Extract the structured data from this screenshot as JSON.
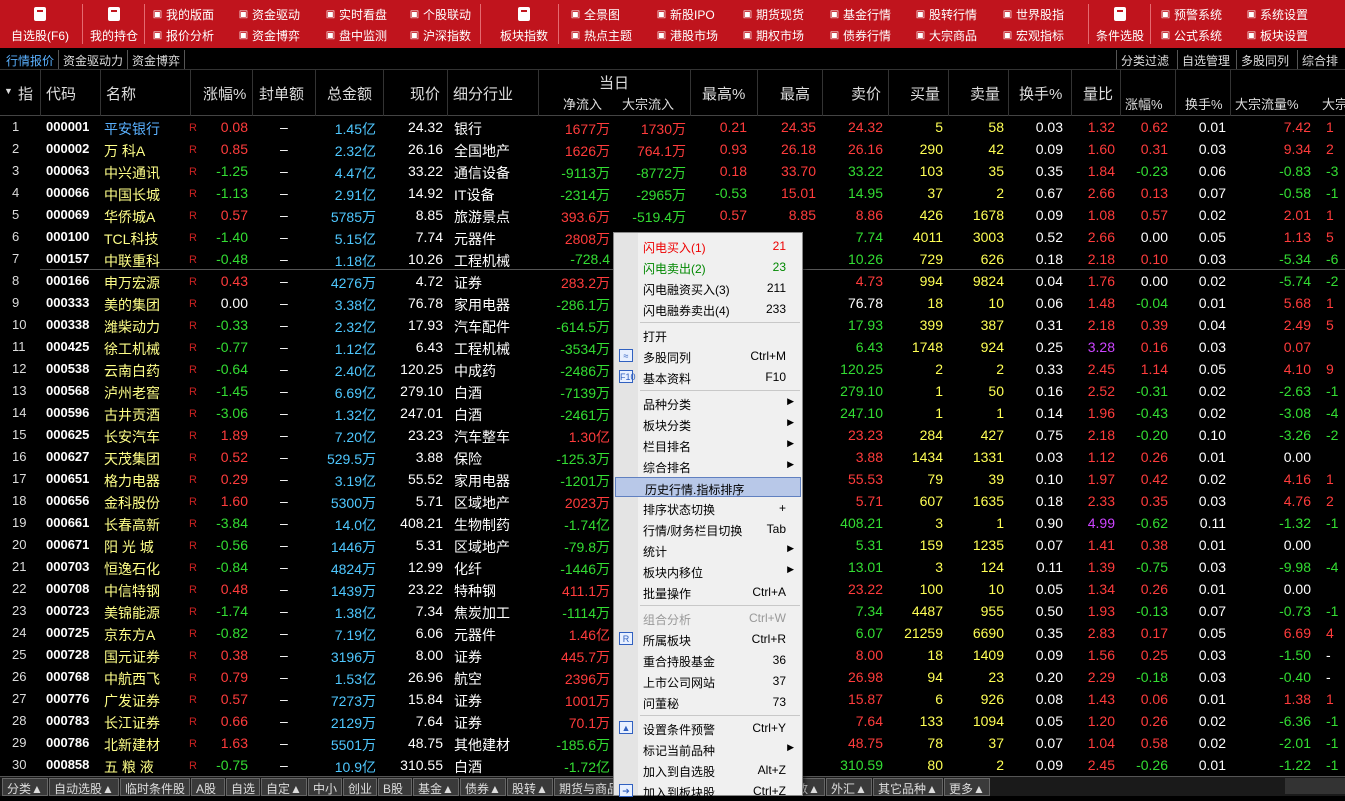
{
  "toolbar": {
    "big": [
      {
        "label": "自选股(F6)",
        "icon": "bookmark-icon"
      },
      {
        "label": "我的持仓",
        "icon": "phone-icon"
      },
      {
        "label": "板块指数",
        "icon": "globe-icon"
      },
      {
        "label": "条件选股",
        "icon": "filter-doc-icon"
      }
    ],
    "small_rows": [
      [
        "我的版面",
        "资金驱动",
        "实时看盘",
        "个股联动"
      ],
      [
        "报价分析",
        "资金博弈",
        "盘中监测",
        "沪深指数"
      ],
      [
        "全景图",
        "新股IPO",
        "期货现货",
        "基金行情",
        "股转行情",
        "世界股指"
      ],
      [
        "热点主题",
        "港股市场",
        "期权市场",
        "债券行情",
        "大宗商品",
        "宏观指标"
      ],
      [
        "预警系统",
        "系统设置"
      ],
      [
        "公式系统",
        "板块设置"
      ]
    ]
  },
  "tabs": [
    "行情报价",
    "资金驱动力",
    "资金博弈"
  ],
  "right_tabs": [
    "分类过滤",
    "自选管理",
    "多股同列",
    "综合排名"
  ],
  "headers": {
    "idx": "指",
    "code": "代码",
    "name": "名称",
    "chg": "涨幅%",
    "seal": "封单额",
    "amt": "总金额",
    "price": "现价",
    "ind": "细分行业",
    "today": "当日",
    "net": "净流入",
    "block": "大宗流入",
    "highp": "最高%",
    "high": "最高",
    "ask": "卖价",
    "bvol": "买量",
    "svol": "卖量",
    "turn": "换手%",
    "vr": "量比",
    "chg2": "涨幅%",
    "turn2": "换手%",
    "bflow": "大宗流量%",
    "bflow2": "大宗"
  },
  "rows": [
    [
      "1",
      "000001",
      "平安银行",
      "0.08",
      "–",
      "1.45亿",
      "24.32",
      "银行",
      "1677万",
      "1730万",
      "0.21",
      "24.35",
      "24.32",
      "5",
      "58",
      "0.03",
      "1.32",
      "0.62",
      "0.01",
      "7.42",
      "1"
    ],
    [
      "2",
      "000002",
      "万 科A",
      "0.85",
      "–",
      "2.32亿",
      "26.16",
      "全国地产",
      "1626万",
      "764.1万",
      "0.93",
      "26.18",
      "26.16",
      "290",
      "42",
      "0.09",
      "1.60",
      "0.31",
      "0.03",
      "9.34",
      "2"
    ],
    [
      "3",
      "000063",
      "中兴通讯",
      "-1.25",
      "–",
      "4.47亿",
      "33.22",
      "通信设备",
      "-9113万",
      "-8772万",
      "0.18",
      "33.70",
      "33.22",
      "103",
      "35",
      "0.35",
      "1.84",
      "-0.23",
      "0.06",
      "-0.83",
      "-3"
    ],
    [
      "4",
      "000066",
      "中国长城",
      "-1.13",
      "–",
      "2.91亿",
      "14.92",
      "IT设备",
      "-2314万",
      "-2965万",
      "-0.53",
      "15.01",
      "14.95",
      "37",
      "2",
      "0.67",
      "2.66",
      "0.13",
      "0.07",
      "-0.58",
      "-1"
    ],
    [
      "5",
      "000069",
      "华侨城A",
      "0.57",
      "–",
      "5785万",
      "8.85",
      "旅游景点",
      "393.6万",
      "-519.4万",
      "0.57",
      "8.85",
      "8.86",
      "426",
      "1678",
      "0.09",
      "1.08",
      "0.57",
      "0.02",
      "2.01",
      "1"
    ],
    [
      "6",
      "000100",
      "TCL科技",
      "-1.40",
      "–",
      "5.15亿",
      "7.74",
      "元器件",
      "2808万",
      "",
      "",
      "",
      "7.74",
      "4011",
      "3003",
      "0.52",
      "2.66",
      "0.00",
      "0.05",
      "1.13",
      "5"
    ],
    [
      "7",
      "000157",
      "中联重科",
      "-0.48",
      "–",
      "1.18亿",
      "10.26",
      "工程机械",
      "-728.4",
      "",
      "",
      "",
      "10.26",
      "729",
      "626",
      "0.18",
      "2.18",
      "0.10",
      "0.03",
      "-5.34",
      "-6"
    ],
    [
      "8",
      "000166",
      "申万宏源",
      "0.43",
      "–",
      "4276万",
      "4.72",
      "证券",
      "283.2万",
      "",
      "",
      "",
      "4.73",
      "994",
      "9824",
      "0.04",
      "1.76",
      "0.00",
      "0.02",
      "-5.74",
      "-2"
    ],
    [
      "9",
      "000333",
      "美的集团",
      "0.00",
      "–",
      "3.38亿",
      "76.78",
      "家用电器",
      "-286.1万",
      "",
      "",
      "",
      "76.78",
      "18",
      "10",
      "0.06",
      "1.48",
      "-0.04",
      "0.01",
      "5.68",
      "1"
    ],
    [
      "10",
      "000338",
      "潍柴动力",
      "-0.33",
      "–",
      "2.32亿",
      "17.93",
      "汽车配件",
      "-614.5万",
      "",
      "",
      "",
      "17.93",
      "399",
      "387",
      "0.31",
      "2.18",
      "0.39",
      "0.04",
      "2.49",
      "5"
    ],
    [
      "11",
      "000425",
      "徐工机械",
      "-0.77",
      "–",
      "1.12亿",
      "6.43",
      "工程机械",
      "-3534万",
      "",
      "",
      "",
      "6.43",
      "1748",
      "924",
      "0.25",
      "3.28",
      "0.16",
      "0.03",
      "0.07",
      ""
    ],
    [
      "12",
      "000538",
      "云南白药",
      "-0.64",
      "–",
      "2.40亿",
      "120.25",
      "中成药",
      "-2486万",
      "",
      "",
      "",
      "120.25",
      "2",
      "2",
      "0.33",
      "2.45",
      "1.14",
      "0.05",
      "4.10",
      "9"
    ],
    [
      "13",
      "000568",
      "泸州老窖",
      "-1.45",
      "–",
      "6.69亿",
      "279.10",
      "白酒",
      "-7139万",
      "",
      "",
      "",
      "279.10",
      "1",
      "50",
      "0.16",
      "2.52",
      "-0.31",
      "0.02",
      "-2.63",
      "-1"
    ],
    [
      "14",
      "000596",
      "古井贡酒",
      "-3.06",
      "–",
      "1.32亿",
      "247.01",
      "白酒",
      "-2461万",
      "",
      "",
      "",
      "247.10",
      "1",
      "1",
      "0.14",
      "1.96",
      "-0.43",
      "0.02",
      "-3.08",
      "-4"
    ],
    [
      "15",
      "000625",
      "长安汽车",
      "1.89",
      "–",
      "7.20亿",
      "23.23",
      "汽车整车",
      "1.30亿",
      "",
      "",
      "",
      "23.23",
      "284",
      "427",
      "0.75",
      "2.18",
      "-0.20",
      "0.10",
      "-3.26",
      "-2"
    ],
    [
      "16",
      "000627",
      "天茂集团",
      "0.52",
      "–",
      "529.5万",
      "3.88",
      "保险",
      "-125.3万",
      "",
      "",
      "",
      "3.88",
      "1434",
      "1331",
      "0.03",
      "1.12",
      "0.26",
      "0.01",
      "0.00",
      ""
    ],
    [
      "17",
      "000651",
      "格力电器",
      "0.29",
      "–",
      "3.19亿",
      "55.52",
      "家用电器",
      "-1201万",
      "",
      "",
      "",
      "55.53",
      "79",
      "39",
      "0.10",
      "1.97",
      "0.42",
      "0.02",
      "4.16",
      "1"
    ],
    [
      "18",
      "000656",
      "金科股份",
      "1.60",
      "–",
      "5300万",
      "5.71",
      "区域地产",
      "2023万",
      "",
      "",
      "",
      "5.71",
      "607",
      "1635",
      "0.18",
      "2.33",
      "0.35",
      "0.03",
      "4.76",
      "2"
    ],
    [
      "19",
      "000661",
      "长春高新",
      "-3.84",
      "–",
      "14.0亿",
      "408.21",
      "生物制药",
      "-1.74亿",
      "",
      "",
      "",
      "408.21",
      "3",
      "1",
      "0.90",
      "4.99",
      "-0.62",
      "0.11",
      "-1.32",
      "-1"
    ],
    [
      "20",
      "000671",
      "阳 光 城",
      "-0.56",
      "–",
      "1446万",
      "5.31",
      "区域地产",
      "-79.8万",
      "",
      "",
      "",
      "5.31",
      "159",
      "1235",
      "0.07",
      "1.41",
      "0.38",
      "0.01",
      "0.00",
      ""
    ],
    [
      "21",
      "000703",
      "恒逸石化",
      "-0.84",
      "–",
      "4824万",
      "12.99",
      "化纤",
      "-1446万",
      "",
      "",
      "",
      "13.01",
      "3",
      "124",
      "0.11",
      "1.39",
      "-0.75",
      "0.03",
      "-9.98",
      "-4"
    ],
    [
      "22",
      "000708",
      "中信特钢",
      "0.48",
      "–",
      "1439万",
      "23.22",
      "特种钢",
      "411.1万",
      "",
      "",
      "",
      "23.22",
      "100",
      "10",
      "0.05",
      "1.34",
      "0.26",
      "0.01",
      "0.00",
      ""
    ],
    [
      "23",
      "000723",
      "美锦能源",
      "-1.74",
      "–",
      "1.38亿",
      "7.34",
      "焦炭加工",
      "-1114万",
      "",
      "",
      "",
      "7.34",
      "4487",
      "955",
      "0.50",
      "1.93",
      "-0.13",
      "0.07",
      "-0.73",
      "-1"
    ],
    [
      "24",
      "000725",
      "京东方A",
      "-0.82",
      "–",
      "7.19亿",
      "6.06",
      "元器件",
      "1.46亿",
      "",
      "",
      "",
      "6.07",
      "21259",
      "6690",
      "0.35",
      "2.83",
      "0.17",
      "0.05",
      "6.69",
      "4"
    ],
    [
      "25",
      "000728",
      "国元证券",
      "0.38",
      "–",
      "3196万",
      "8.00",
      "证券",
      "445.7万",
      "",
      "",
      "",
      "8.00",
      "18",
      "1409",
      "0.09",
      "1.56",
      "0.25",
      "0.03",
      "-1.50",
      "-"
    ],
    [
      "26",
      "000768",
      "中航西飞",
      "0.79",
      "–",
      "1.53亿",
      "26.96",
      "航空",
      "2396万",
      "",
      "",
      "",
      "26.98",
      "94",
      "23",
      "0.20",
      "2.29",
      "-0.18",
      "0.03",
      "-0.40",
      "-"
    ],
    [
      "27",
      "000776",
      "广发证券",
      "0.57",
      "–",
      "7273万",
      "15.84",
      "证券",
      "1001万",
      "",
      "",
      "",
      "15.87",
      "6",
      "926",
      "0.08",
      "1.43",
      "0.06",
      "0.01",
      "1.38",
      "1"
    ],
    [
      "28",
      "000783",
      "长江证券",
      "0.66",
      "–",
      "2129万",
      "7.64",
      "证券",
      "70.1万",
      "",
      "",
      "",
      "7.64",
      "133",
      "1094",
      "0.05",
      "1.20",
      "0.26",
      "0.02",
      "-6.36",
      "-1"
    ],
    [
      "29",
      "000786",
      "北新建材",
      "1.63",
      "–",
      "5501万",
      "48.75",
      "其他建材",
      "-185.6万",
      "",
      "",
      "",
      "48.75",
      "78",
      "37",
      "0.07",
      "1.04",
      "0.58",
      "0.02",
      "-2.01",
      "-1"
    ],
    [
      "30",
      "000858",
      "五 粮 液",
      "-0.75",
      "–",
      "10.9亿",
      "310.55",
      "白酒",
      "-1.72亿",
      "",
      "",
      "",
      "310.59",
      "80",
      "2",
      "0.09",
      "2.45",
      "-0.26",
      "0.01",
      "-1.22",
      "-1"
    ]
  ],
  "menu": [
    {
      "label": "闪电买入(1)",
      "sc": "21",
      "type": "red"
    },
    {
      "label": "闪电卖出(2)",
      "sc": "23",
      "type": "grn"
    },
    {
      "label": "闪电融资买入(3)",
      "sc": "211"
    },
    {
      "label": "闪电融券卖出(4)",
      "sc": "233"
    },
    {
      "sep": true
    },
    {
      "label": "打开",
      "sc": ""
    },
    {
      "label": "多股同列",
      "sc": "Ctrl+M",
      "icon": "chart-icon"
    },
    {
      "label": "基本资料",
      "sc": "F10",
      "icon": "f10-icon"
    },
    {
      "sep": true
    },
    {
      "label": "品种分类",
      "sub": true
    },
    {
      "label": "板块分类",
      "sub": true
    },
    {
      "label": "栏目排名",
      "sub": true
    },
    {
      "label": "综合排名",
      "sub": true
    },
    {
      "label": "历史行情.指标排序",
      "sc": "",
      "hl": true
    },
    {
      "label": "排序状态切换",
      "sc": "+"
    },
    {
      "label": "行情/财务栏目切换",
      "sc": "Tab"
    },
    {
      "label": "统计",
      "sub": true
    },
    {
      "label": "板块内移位",
      "sub": true
    },
    {
      "label": "批量操作",
      "sc": "Ctrl+A"
    },
    {
      "sep": true
    },
    {
      "label": "组合分析",
      "sc": "Ctrl+W",
      "dis": true
    },
    {
      "label": "所属板块",
      "sc": "Ctrl+R",
      "icon": "r-icon"
    },
    {
      "label": "重合持股基金",
      "sc": "36"
    },
    {
      "label": "上市公司网站",
      "sc": "37"
    },
    {
      "label": "问董秘",
      "sc": "73"
    },
    {
      "sep": true
    },
    {
      "label": "设置条件预警",
      "sc": "Ctrl+Y",
      "icon": "alert-icon"
    },
    {
      "label": "标记当前品种",
      "sub": true
    },
    {
      "label": "加入到自选股",
      "sc": "Alt+Z"
    },
    {
      "label": "加入到板块股",
      "sc": "Ctrl+Z",
      "icon": "add-icon"
    }
  ],
  "bottom_tabs": [
    "分类▲",
    "自动选股▲",
    "临时条件股",
    "A股",
    "自选",
    "自定▲",
    "中小",
    "创业",
    "B股",
    "基金▲",
    "债券▲",
    "股转▲",
    "期货与商品▲",
    "期权▲",
    "基金理财▲",
    "全球指数▲",
    "外汇▲",
    "其它品种▲",
    "更多▲"
  ]
}
